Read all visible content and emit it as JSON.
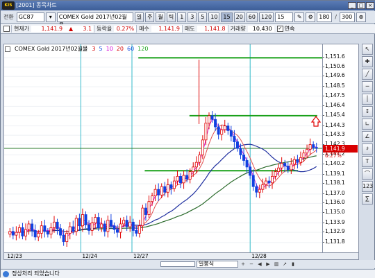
{
  "window": {
    "title": "[2001] 종목차트",
    "logo": "KIS"
  },
  "toolbar": {
    "query_label": "전환",
    "symbol": "GC87",
    "symbol_name": "COMEX Gold 2017년02월물",
    "periods": [
      "일",
      "주",
      "월",
      "틱"
    ],
    "minutes": [
      "1",
      "3",
      "5",
      "10",
      "15",
      "20",
      "60",
      "120"
    ],
    "selected_minute": "15",
    "interval_value": "15",
    "count_a": "180",
    "count_b": "300"
  },
  "quote": {
    "price_label": "현재가",
    "price": "1,141.9",
    "change_arrow": "▲",
    "change": "3.1",
    "rate_label": "등락율",
    "rate": "0.27%",
    "bid_label": "매수",
    "bid": "1,141.9",
    "ask_label": "매도",
    "ask": "1,141.8",
    "volume_label": "거래량",
    "volume": "10,430",
    "linked_label": "연속"
  },
  "legend": {
    "name": "COMEX Gold 2017년02월물",
    "ma": [
      {
        "label": "3",
        "color": "#d40000"
      },
      {
        "label": "5",
        "color": "#1a4fe0"
      },
      {
        "label": "10",
        "color": "#d400d4"
      },
      {
        "label": "20",
        "color": "#d40000"
      },
      {
        "label": "60",
        "color": "#1a4fe0"
      },
      {
        "label": "120",
        "color": "#19a319"
      }
    ]
  },
  "colors": {
    "up": "#e00000",
    "down": "#1040e0",
    "ma_short": "#e05050",
    "ma_mid": "#2030a0",
    "ma_long": "#2a6a2a",
    "hline": "#18a018",
    "vline": "#30b8c8"
  },
  "chart_data": {
    "type": "candlestick",
    "ylim": [
      1131.2,
      1152.0
    ],
    "yticks": [
      "1,151.6",
      "1,150.6",
      "1,149.6",
      "1,148.5",
      "1,147.5",
      "1,146.4",
      "1,145.4",
      "1,144.3",
      "1,143.3",
      "1,142.3",
      "1,141.2",
      "1,140.2",
      "1,139.1",
      "1,138.1",
      "1,137.0",
      "1,136.0",
      "1,135.0",
      "1,133.9",
      "1,132.9",
      "1,131.8"
    ],
    "xticks": [
      "12/23",
      "12/24",
      "12/27",
      "12/28"
    ],
    "last_price": "1,141.9",
    "last_change_pct": "0.27%",
    "hlines": [
      1151.6,
      1145.4,
      1139.5
    ],
    "series_close": [
      1133.0,
      1132.6,
      1132.9,
      1133.4,
      1132.5,
      1133.2,
      1133.8,
      1133.1,
      1132.4,
      1132.8,
      1133.6,
      1133.0,
      1132.7,
      1133.4,
      1134.0,
      1133.3,
      1132.6,
      1131.9,
      1132.8,
      1133.5,
      1133.0,
      1134.4,
      1133.6,
      1134.8,
      1133.7,
      1133.1,
      1133.9,
      1134.5,
      1133.4,
      1133.8,
      1133.0,
      1134.2,
      1133.6,
      1133.2,
      1132.9,
      1133.8,
      1134.2,
      1133.5,
      1134.0,
      1133.1,
      1132.8,
      1133.6,
      1135.5,
      1134.8,
      1136.2,
      1136.8,
      1137.5,
      1136.9,
      1137.8,
      1137.2,
      1138.0,
      1137.6,
      1138.4,
      1138.9,
      1138.2,
      1139.0,
      1138.6,
      1139.4,
      1139.9,
      1140.4,
      1141.2,
      1142.8,
      1144.6,
      1145.4,
      1145.0,
      1144.2,
      1143.4,
      1143.9,
      1144.3,
      1143.8,
      1143.2,
      1142.6,
      1141.9,
      1141.2,
      1140.6,
      1139.9,
      1139.0,
      1137.8,
      1137.2,
      1137.5,
      1138.0,
      1138.4,
      1138.2,
      1138.9,
      1139.4,
      1139.8,
      1140.3,
      1140.0,
      1139.6,
      1140.2,
      1140.7,
      1140.4,
      1140.9,
      1141.4,
      1141.8,
      1142.3,
      1142.0,
      1141.9
    ]
  },
  "bottom": {
    "chart_style": "일봉식"
  },
  "status": {
    "message": "정상처리 되었습니다"
  },
  "right_tools": [
    "↖",
    "✚",
    "╱",
    "─",
    "│",
    "↕",
    "∟",
    "∠",
    "♯",
    "T",
    "⌒",
    "123",
    "∑"
  ]
}
